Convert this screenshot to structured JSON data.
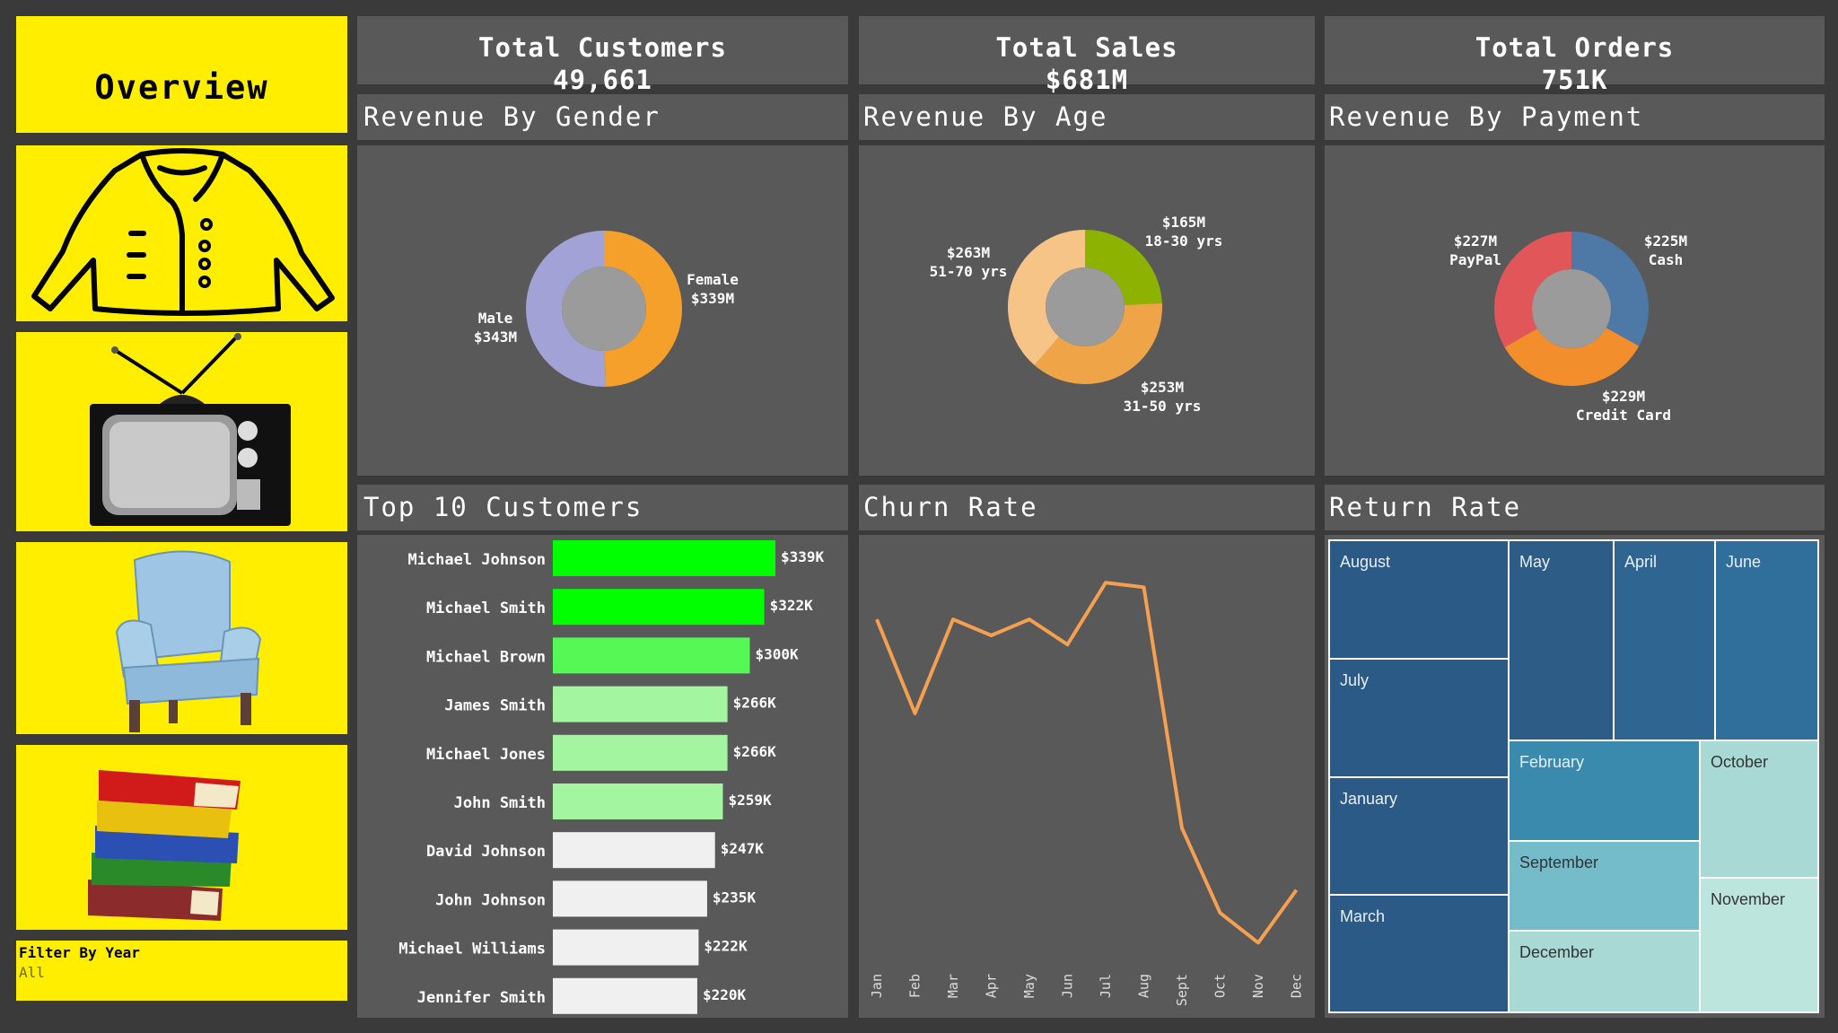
{
  "sidebar": {
    "overview_label": "Overview",
    "categories": [
      "jacket-icon",
      "tv-icon",
      "armchair-icon",
      "books-icon"
    ],
    "filter": {
      "label": "Filter By Year",
      "value": "All"
    }
  },
  "kpis": [
    {
      "title": "Total Customers",
      "value": "49,661"
    },
    {
      "title": "Total Sales",
      "value": "$681M"
    },
    {
      "title": "Total Orders",
      "value": "751K"
    }
  ],
  "titles": {
    "gender": "Revenue By Gender",
    "age": "Revenue By Age",
    "payment": "Revenue By Payment",
    "top10": "Top 10 Customers",
    "churn": "Churn Rate",
    "returns": "Return Rate"
  },
  "colors": {
    "yellow": "#ffee00",
    "panel": "#595959",
    "background": "#3a3a3a",
    "line": "#f5a050"
  },
  "chart_data": [
    {
      "id": "gender",
      "type": "pie",
      "donut": true,
      "slices": [
        {
          "label": "Female",
          "value_label": "$339M",
          "value": 339,
          "color": "#f5a02a"
        },
        {
          "label": "Male",
          "value_label": "$343M",
          "value": 343,
          "color": "#a3a2d6"
        }
      ]
    },
    {
      "id": "age",
      "type": "pie",
      "donut": true,
      "slices": [
        {
          "label": "18-30 yrs",
          "value_label": "$165M",
          "value": 165,
          "color": "#8db200"
        },
        {
          "label": "31-50 yrs",
          "value_label": "$253M",
          "value": 253,
          "color": "#f0a448"
        },
        {
          "label": "51-70 yrs",
          "value_label": "$263M",
          "value": 263,
          "color": "#f7c487"
        }
      ]
    },
    {
      "id": "payment",
      "type": "pie",
      "donut": true,
      "slices": [
        {
          "label": "Cash",
          "value_label": "$225M",
          "value": 225,
          "color": "#4e79a7"
        },
        {
          "label": "Credit Card",
          "value_label": "$229M",
          "value": 229,
          "color": "#f28e2b"
        },
        {
          "label": "PayPal",
          "value_label": "$227M",
          "value": 227,
          "color": "#e15759"
        }
      ]
    },
    {
      "id": "top10",
      "type": "bar",
      "orientation": "horizontal",
      "categories": [
        "Michael Johnson",
        "Michael Smith",
        "Michael Brown",
        "James Smith",
        "Michael Jones",
        "John Smith",
        "David Johnson",
        "John Johnson",
        "Michael Williams",
        "Jennifer Smith"
      ],
      "values": [
        339,
        322,
        300,
        266,
        266,
        259,
        247,
        235,
        222,
        220
      ],
      "value_labels": [
        "$339K",
        "$322K",
        "$300K",
        "$266K",
        "$266K",
        "$259K",
        "$247K",
        "$235K",
        "$222K",
        "$220K"
      ],
      "colors": [
        "#00ff00",
        "#00ff00",
        "#55f855",
        "#a3f5a0",
        "#a3f5a0",
        "#a3f5a0",
        "#f0f0f0",
        "#f0f0f0",
        "#f0f0f0",
        "#f0f0f0"
      ],
      "units": "thousands of dollars"
    },
    {
      "id": "churn",
      "type": "line",
      "x": [
        "Jan",
        "Feb",
        "Mar",
        "Apr",
        "May",
        "Jun",
        "Jul",
        "Aug",
        "Sept",
        "Oct",
        "Nov",
        "Dec"
      ],
      "y": [
        8.6,
        4.5,
        8.6,
        7.9,
        8.6,
        7.5,
        10.2,
        10.0,
        -0.5,
        -4.2,
        -5.5,
        -3.2
      ],
      "ylim": [
        -6.5,
        11.5
      ],
      "grid": false
    },
    {
      "id": "returns",
      "type": "heatmap",
      "subtype": "treemap",
      "items": [
        {
          "label": "August",
          "color": "#2c5a86"
        },
        {
          "label": "July",
          "color": "#2c5a86"
        },
        {
          "label": "January",
          "color": "#2c5a86"
        },
        {
          "label": "March",
          "color": "#2c5a86"
        },
        {
          "label": "May",
          "color": "#2d5d87"
        },
        {
          "label": "April",
          "color": "#2f6591"
        },
        {
          "label": "June",
          "color": "#306f9b"
        },
        {
          "label": "February",
          "color": "#3a8aae"
        },
        {
          "label": "September",
          "color": "#75bccb"
        },
        {
          "label": "December",
          "color": "#a8d9d5"
        },
        {
          "label": "October",
          "color": "#a8d9d5"
        },
        {
          "label": "November",
          "color": "#bce6dd"
        }
      ]
    }
  ]
}
